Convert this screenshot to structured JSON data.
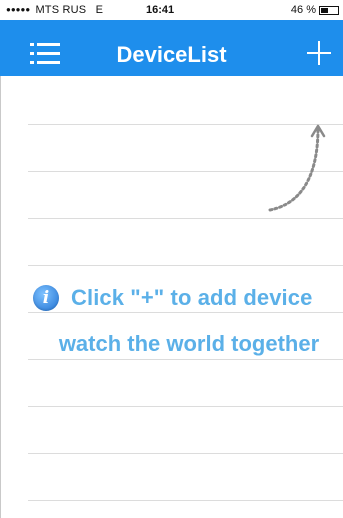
{
  "status_bar": {
    "signal_dots": "●●●●●",
    "carrier": "MTS RUS",
    "network": "E",
    "time": "16:41",
    "battery_percent": "46 %",
    "battery_level": 0.46
  },
  "nav": {
    "title": "DeviceList",
    "menu_icon": "list-menu-icon",
    "add_icon": "plus-icon",
    "background_color": "#1e8eec"
  },
  "hint": {
    "icon": "info-icon",
    "line1": "Click \"+\" to add device",
    "line2": "watch the world together",
    "text_color": "#5bb0e8"
  }
}
